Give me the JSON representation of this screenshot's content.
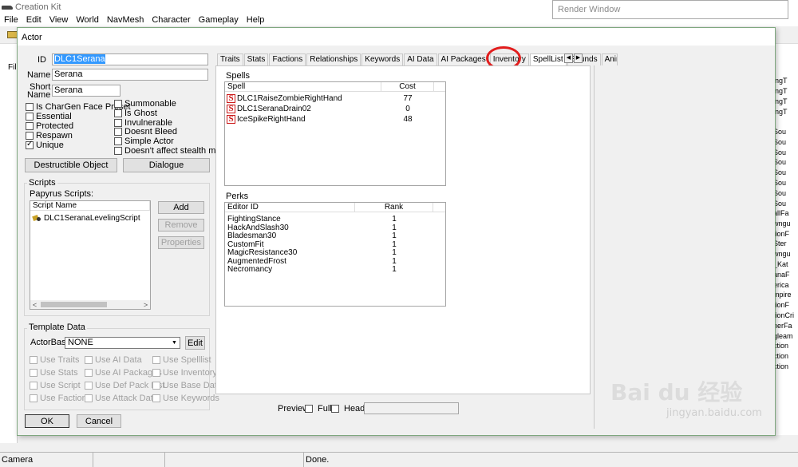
{
  "app": {
    "title": "Creation Kit",
    "menu": [
      "File",
      "Edit",
      "View",
      "World",
      "NavMesh",
      "Character",
      "Gameplay",
      "Help"
    ],
    "render_window_title": "Render Window",
    "side_label": "Fil"
  },
  "right_pane": {
    "items": [
      "ingT",
      "ingT",
      "ingT",
      "ingT",
      "Sou",
      "Sou",
      "Sou",
      "Sou",
      "Sou",
      "Sou",
      "Sou",
      "Sou",
      "allFa",
      "wngu",
      "tionF",
      "Ster",
      "wngu",
      "_Kat",
      "anaF",
      "erica",
      "mpire",
      "tionF",
      "tionCri",
      "herFa",
      "gleam",
      "ction",
      "ction",
      "ction"
    ]
  },
  "dialog": {
    "title": "Actor",
    "id_label": "ID",
    "id_value": "DLC1Serana",
    "name_label": "Name",
    "name_value": "Serana",
    "short_name_label_1": "Short",
    "short_name_label_2": "Name",
    "short_name_value": "Serana",
    "flags_left": [
      {
        "label": "Is CharGen Face Preset",
        "checked": false
      },
      {
        "label": "Essential",
        "checked": false
      },
      {
        "label": "Protected",
        "checked": false
      },
      {
        "label": "Respawn",
        "checked": false
      },
      {
        "label": "Unique",
        "checked": true
      }
    ],
    "flags_right": [
      {
        "label": "Summonable",
        "checked": false
      },
      {
        "label": "Is Ghost",
        "checked": false
      },
      {
        "label": "Invulnerable",
        "checked": false
      },
      {
        "label": "Doesnt Bleed",
        "checked": false
      },
      {
        "label": "Simple Actor",
        "checked": false
      },
      {
        "label": "Doesn't affect stealth meter",
        "checked": false
      }
    ],
    "destructible_button": "Destructible Object",
    "dialogue_button": "Dialogue",
    "scripts": {
      "group_label": "Scripts",
      "papyrus_label": "Papyrus Scripts:",
      "column": "Script Name",
      "items": [
        "DLC1SeranaLevelingScript"
      ],
      "add": "Add",
      "remove": "Remove",
      "properties": "Properties"
    },
    "template": {
      "group_label": "Template Data",
      "actorbase_label": "ActorBase",
      "actorbase_value": "NONE",
      "edit": "Edit",
      "flags": [
        [
          "Use Traits",
          "Use AI Data",
          "Use Spelllist"
        ],
        [
          "Use Stats",
          "Use AI Packages",
          "Use Inventory"
        ],
        [
          "Use Script",
          "Use Def Pack List",
          "Use Base Data"
        ],
        [
          "Use Factions",
          "Use Attack Data",
          "Use Keywords"
        ]
      ]
    },
    "ok": "OK",
    "cancel": "Cancel",
    "tabs": [
      "Traits",
      "Stats",
      "Factions",
      "Relationships",
      "Keywords",
      "AI Data",
      "AI Packages",
      "Inventory",
      "SpellList",
      "Sounds",
      "Anim"
    ],
    "active_tab": "SpellList",
    "spells": {
      "label": "Spells",
      "columns": [
        "Spell",
        "Cost"
      ],
      "rows": [
        {
          "name": "DLC1RaiseZombieRightHand",
          "cost": "77"
        },
        {
          "name": "DLC1SeranaDrain02",
          "cost": "0"
        },
        {
          "name": "IceSpikeRightHand",
          "cost": "48"
        }
      ]
    },
    "perks": {
      "label": "Perks",
      "columns": [
        "Editor ID",
        "Rank"
      ],
      "rows": [
        {
          "id": "FightingStance",
          "rank": "1"
        },
        {
          "id": "HackAndSlash30",
          "rank": "1"
        },
        {
          "id": "Bladesman30",
          "rank": "1"
        },
        {
          "id": "CustomFit",
          "rank": "1"
        },
        {
          "id": "MagicResistance30",
          "rank": "1"
        },
        {
          "id": "AugmentedFrost",
          "rank": "1"
        },
        {
          "id": "Necromancy",
          "rank": "1"
        }
      ]
    },
    "preview": {
      "label": "Preview",
      "full": "Full",
      "head": "Head"
    }
  },
  "statusbar": {
    "left": "Camera",
    "right": "Done."
  },
  "watermark": {
    "line1": "Bai du 经验",
    "line2": "jingyan.baidu.com"
  },
  "colors": {
    "highlight_circle": "#e21d1d",
    "selection": "#3399ff",
    "spell_icon": "#cc1b1b"
  }
}
